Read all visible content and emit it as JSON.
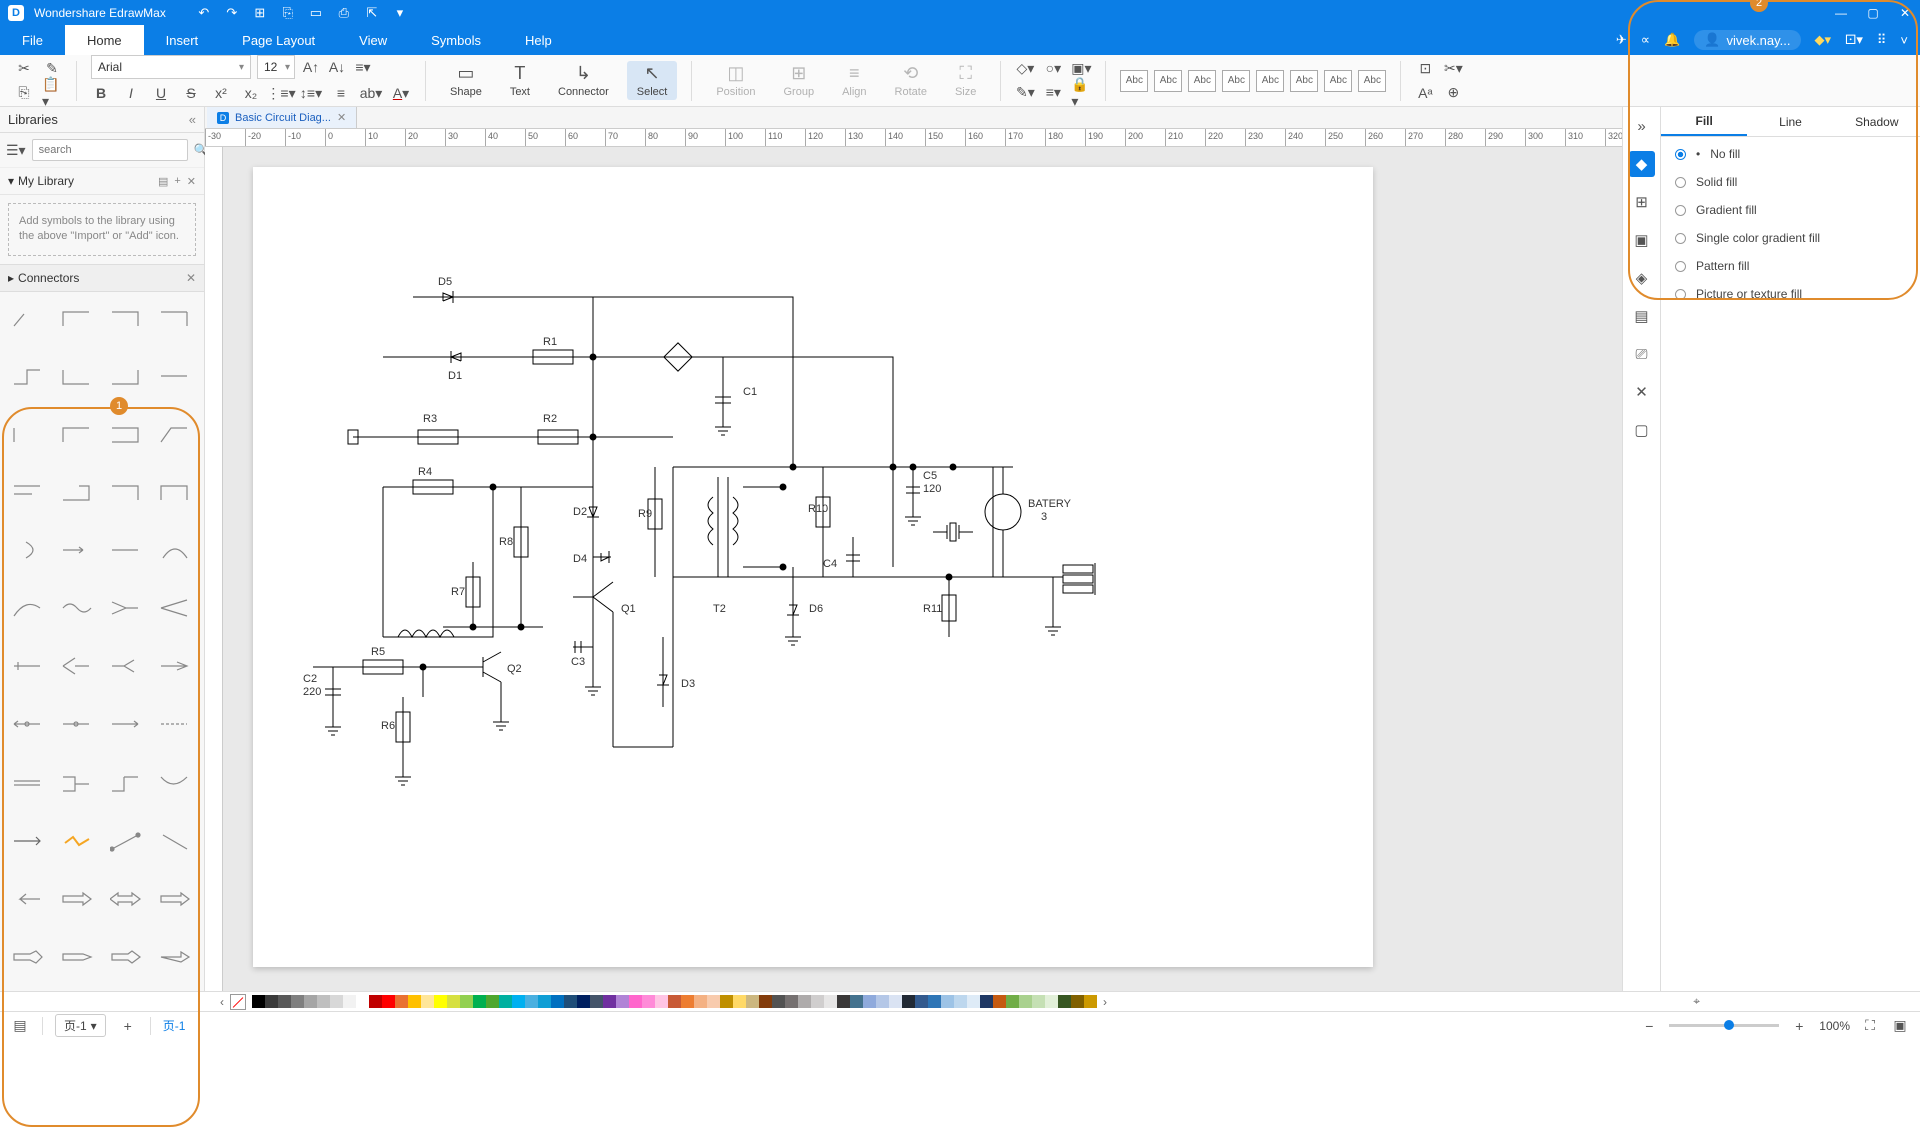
{
  "app": {
    "title": "Wondershare EdrawMax",
    "user": "vivek.nay..."
  },
  "menu": {
    "items": [
      "File",
      "Home",
      "Insert",
      "Page Layout",
      "View",
      "Symbols",
      "Help"
    ],
    "active": "Home"
  },
  "ribbon": {
    "font": "Arial",
    "fontSize": "12",
    "tools": {
      "shape": "Shape",
      "text": "Text",
      "connector": "Connector",
      "select": "Select",
      "position": "Position",
      "group": "Group",
      "align": "Align",
      "rotate": "Rotate",
      "size": "Size"
    },
    "abc": "Abc"
  },
  "leftPanel": {
    "title": "Libraries",
    "searchPlaceholder": "search",
    "myLibrary": "My Library",
    "hint": "Add symbols to the library using the above \"Import\" or \"Add\" icon.",
    "connectors": "Connectors"
  },
  "tab": {
    "label": "Basic Circuit Diag..."
  },
  "ruler": {
    "ticks": [
      "-30",
      "-20",
      "-10",
      "0",
      "10",
      "20",
      "30",
      "40",
      "50",
      "60",
      "70",
      "80",
      "90",
      "100",
      "110",
      "120",
      "130",
      "140",
      "150",
      "160",
      "170",
      "180",
      "190",
      "200",
      "210",
      "220",
      "230",
      "240",
      "250",
      "260",
      "270",
      "280",
      "290",
      "300",
      "310",
      "320"
    ]
  },
  "rightPanel": {
    "tabs": [
      "Fill",
      "Line",
      "Shadow"
    ],
    "activeTab": "Fill",
    "fillOptions": [
      "No fill",
      "Solid fill",
      "Gradient fill",
      "Single color gradient fill",
      "Pattern fill",
      "Picture or texture fill"
    ],
    "selected": "No fill"
  },
  "status": {
    "pageLabel": "页-1",
    "pageTab": "页-1",
    "zoom": "100%"
  },
  "circuit": {
    "labels": {
      "D5": "D5",
      "R1": "R1",
      "D1": "D1",
      "R3": "R3",
      "R2": "R2",
      "C1": "C1",
      "R4": "R4",
      "D2": "D2",
      "R9": "R9",
      "D4": "D4",
      "R8": "R8",
      "R7": "R7",
      "Q1": "Q1",
      "C3": "C3",
      "R5": "R5",
      "Q2": "Q2",
      "R6": "R6",
      "C2": "C2",
      "C2v": "220",
      "D3": "D3",
      "T2": "T2",
      "D6": "D6",
      "R10": "R10",
      "C4": "C4",
      "C5": "C5",
      "C5v": "120",
      "R11": "R11",
      "BAT": "BATERY",
      "BATn": "3"
    }
  },
  "callouts": {
    "left": "1",
    "right": "2"
  },
  "colors": [
    "#000000",
    "#3b3b3b",
    "#595959",
    "#7f7f7f",
    "#a5a5a5",
    "#bfbfbf",
    "#d8d8d8",
    "#f2f2f2",
    "#ffffff",
    "#c00000",
    "#ff0000",
    "#e97132",
    "#ffc000",
    "#ffe699",
    "#ffff00",
    "#d6e040",
    "#92d050",
    "#00b050",
    "#4ea72e",
    "#00b0a0",
    "#00b0f0",
    "#4ab0e0",
    "#0f9ed5",
    "#0070c0",
    "#1f4e79",
    "#002060",
    "#44546a",
    "#7030a0",
    "#b083d6",
    "#ff66cc",
    "#ff8ad8",
    "#ffc4e4",
    "#c85a36",
    "#ed7d31",
    "#f4b183",
    "#f8cbad",
    "#bf8f00",
    "#ffd966",
    "#ccb77f",
    "#833c0b",
    "#525252",
    "#757070",
    "#aeabab",
    "#d0cece",
    "#e7e6e6",
    "#3a3838",
    "#44728e",
    "#8faadc",
    "#b4c7e7",
    "#dae3f3",
    "#222a35",
    "#335a8e",
    "#2e75b6",
    "#9dc3e6",
    "#bdd7ee",
    "#deebf7",
    "#1f3864",
    "#c55a11",
    "#70ad47",
    "#a9d18e",
    "#c5e0b4",
    "#e2f0d9",
    "#385723",
    "#806000",
    "#cc9900"
  ]
}
